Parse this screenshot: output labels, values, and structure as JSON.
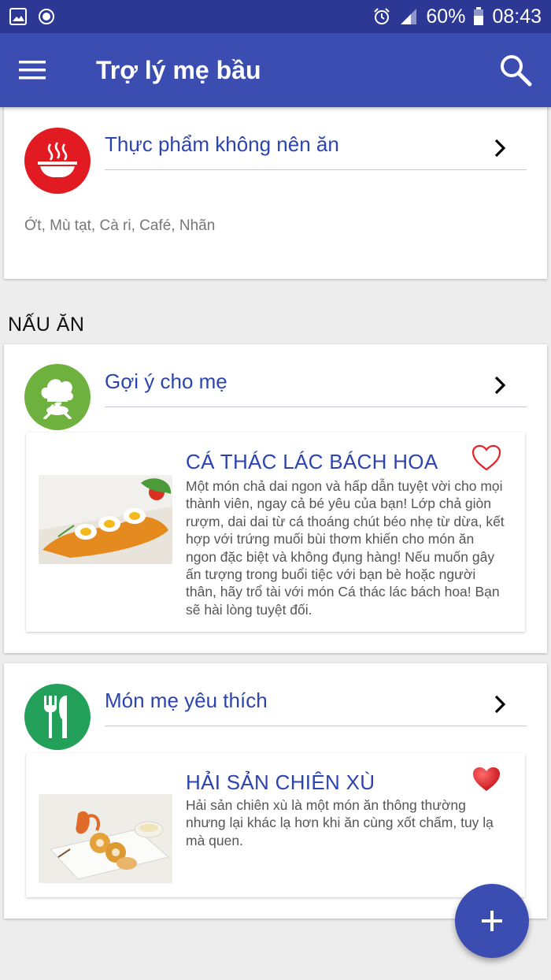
{
  "status_bar": {
    "battery": "60%",
    "time": "08:43",
    "icons": [
      "image-icon",
      "record-icon",
      "alarm-icon",
      "signal-icon",
      "battery-icon"
    ]
  },
  "app_bar": {
    "title": "Trợ lý mẹ bầu",
    "icons": [
      "menu-icon",
      "search-icon"
    ]
  },
  "avoid_card": {
    "title": "Thực phẩm không nên ăn",
    "foods": "Ớt, Mù tạt, Cà ri, Café, Nhãn",
    "icon": "soup-bowl-icon",
    "icon_color": "#e21b23"
  },
  "cooking_section": {
    "label": "NẤU ĂN"
  },
  "suggest_card": {
    "title": "Gợi ý cho mẹ",
    "icon": "chef-hat-icon",
    "icon_color": "#6fb13f",
    "recipe": {
      "title": "CÁ THÁC LÁC BÁCH HOA",
      "description": "Một món chả dai ngon và hấp dẫn tuyệt vời cho mọi thành viên, ngay cả bé yêu của bạn! Lớp chả giòn rượm, dai dai từ cá thoáng chút béo nhẹ từ dừa, kết hợp với trứng muối bùi thơm khiến cho món ăn ngon đặc biệt và không đụng hàng! Nếu muốn gây ấn tượng trong buổi tiệc với bạn bè hoặc người thân, hãy trổ tài với món Cá thác lác bách hoa! Bạn sẽ hài lòng tuyệt đối.",
      "favorite": false
    }
  },
  "favorite_card": {
    "title": "Món mẹ yêu thích",
    "icon": "fork-knife-icon",
    "icon_color": "#23a15a",
    "recipe": {
      "title": "HẢI SẢN CHIÊN XÙ",
      "description": "Hải sản chiên xù là một món ăn thông thường nhưng lại khác lạ hơn khi ăn cùng xốt chấm, tuy lạ mà quen.",
      "favorite": true
    }
  },
  "fab": {
    "icon": "plus-icon"
  },
  "colors": {
    "primary": "#3b4db1",
    "status_bar": "#2c3893",
    "accent_text": "#2c44b0",
    "heart": "#e0262a"
  }
}
